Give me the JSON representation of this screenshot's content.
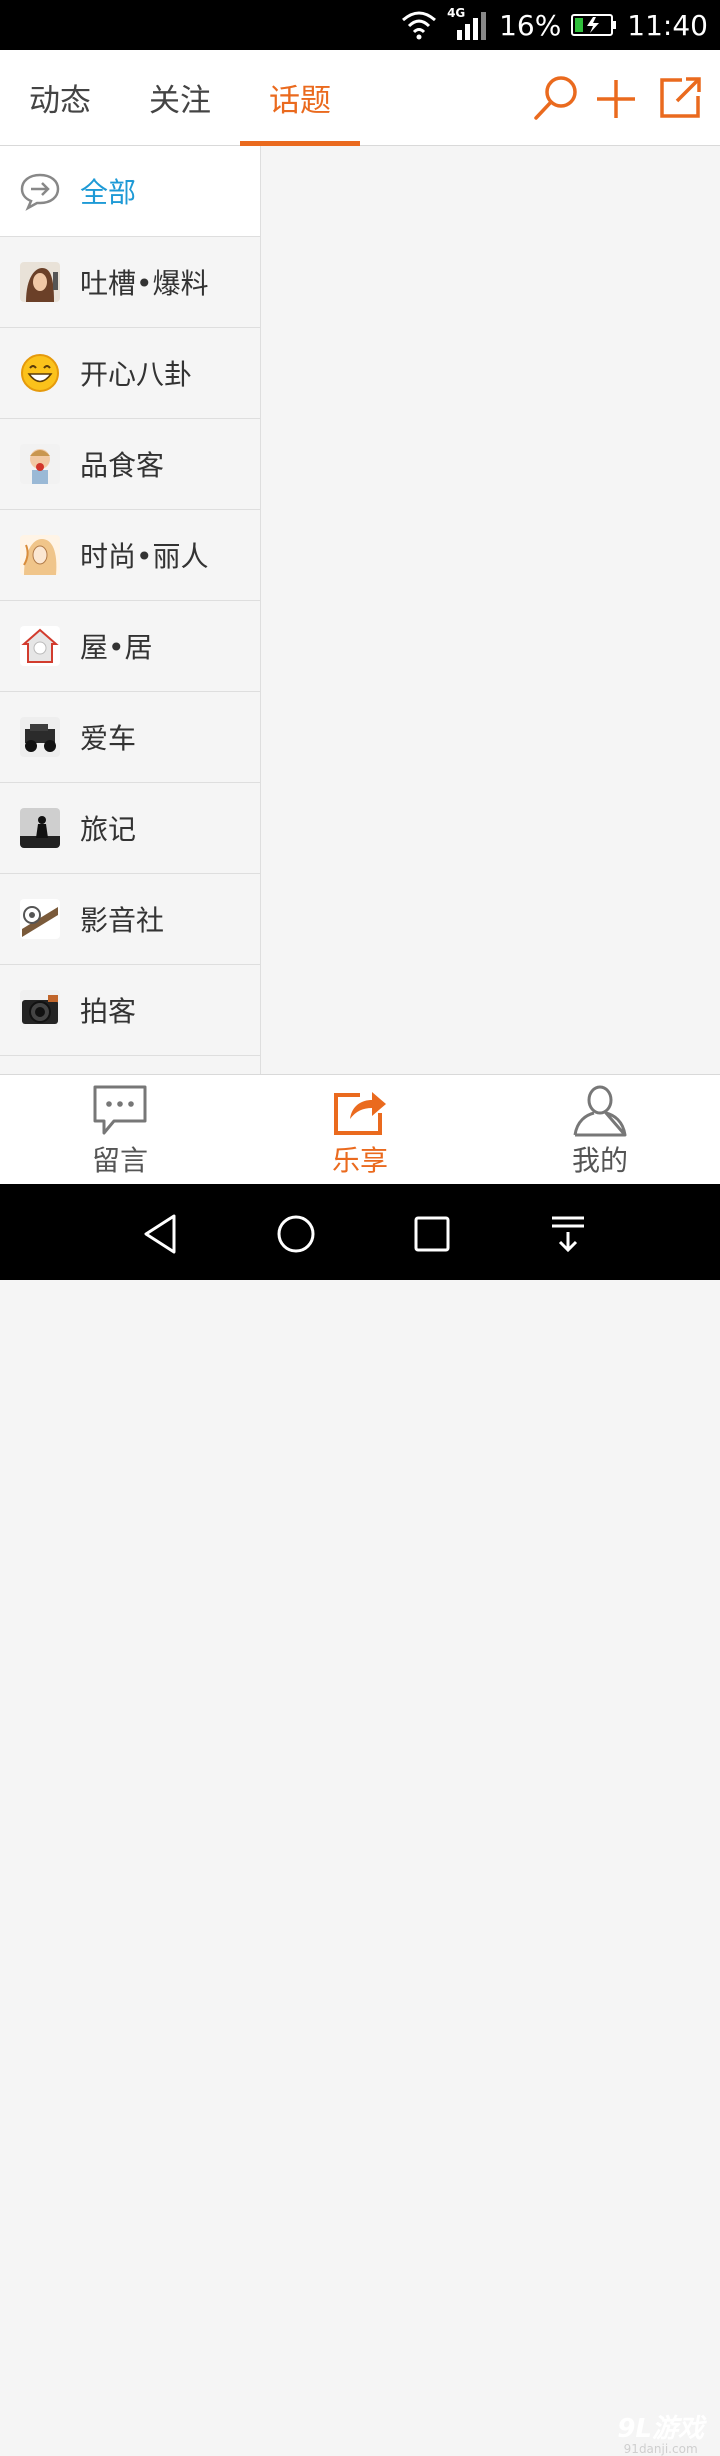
{
  "status_bar": {
    "network": "4G",
    "battery": "16%",
    "time": "11:40"
  },
  "header": {
    "tabs": [
      {
        "label": "动态",
        "active": false
      },
      {
        "label": "关注",
        "active": false
      },
      {
        "label": "话题",
        "active": true
      }
    ],
    "icons": [
      "search-icon",
      "add-icon",
      "share-icon"
    ]
  },
  "sidebar": {
    "items": [
      {
        "label": "全部",
        "icon": "chat-bubble-arrow-icon",
        "active": true
      },
      {
        "label": "吐槽•爆料",
        "icon": "girl-thumbnail"
      },
      {
        "label": "开心八卦",
        "icon": "smiley-face-thumbnail"
      },
      {
        "label": "品食客",
        "icon": "child-eating-thumbnail"
      },
      {
        "label": "时尚•丽人",
        "icon": "fashion-sketch-thumbnail"
      },
      {
        "label": "屋•居",
        "icon": "house-thumbnail"
      },
      {
        "label": "爱车",
        "icon": "jeep-thumbnail"
      },
      {
        "label": "旅记",
        "icon": "traveler-silhouette-thumbnail"
      },
      {
        "label": "影音社",
        "icon": "film-reel-thumbnail"
      },
      {
        "label": "拍客",
        "icon": "camera-thumbnail"
      }
    ]
  },
  "bottom_nav": [
    {
      "label": "留言",
      "icon": "message-icon",
      "active": false
    },
    {
      "label": "乐享",
      "icon": "share-box-icon",
      "active": true
    },
    {
      "label": "我的",
      "icon": "profile-icon",
      "active": false
    }
  ],
  "watermark": {
    "main": "9L游戏",
    "sub": "91danji.com"
  },
  "colors": {
    "accent": "#ea6a1e",
    "active_side": "#1e9ad6",
    "text": "#333333"
  }
}
